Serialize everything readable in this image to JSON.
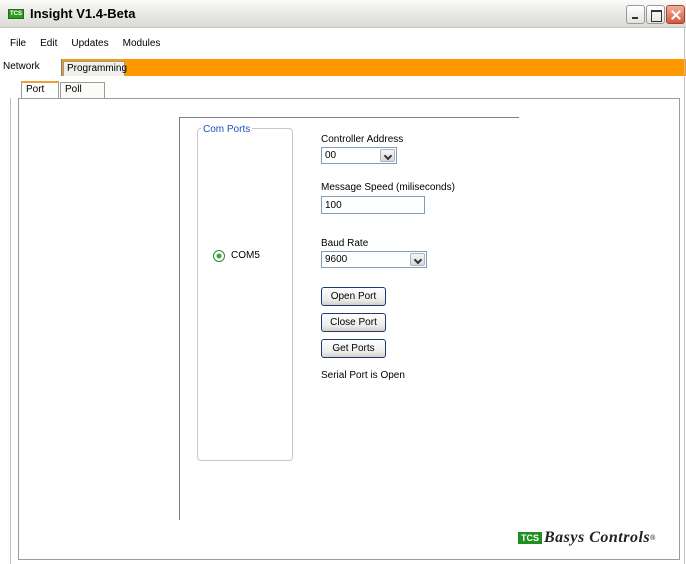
{
  "window": {
    "title": "Insight V1.4-Beta",
    "app_icon": "TCS"
  },
  "menu": {
    "items": [
      "File",
      "Edit",
      "Updates",
      "Modules"
    ]
  },
  "tabs_top": [
    "Network",
    "Programming"
  ],
  "tabs_inner": [
    "Port",
    "Poll"
  ],
  "com_ports": {
    "group_label": "Com Ports",
    "port": "COM5"
  },
  "form": {
    "controller_address_label": "Controller Address",
    "controller_address_value": "00",
    "message_speed_label": "Message Speed (miliseconds)",
    "message_speed_value": "100",
    "baud_rate_label": "Baud Rate",
    "baud_rate_value": "9600",
    "open_port": "Open Port",
    "close_port": "Close Port",
    "get_ports": "Get Ports",
    "status": "Serial Port is Open"
  },
  "logo": {
    "tcs": "TCS",
    "text": "Basys Controls",
    "reg": "®"
  },
  "colors": {
    "accent": "#ff9800",
    "title_green": "#2f9a1f",
    "group_label": "#1a50c0"
  }
}
